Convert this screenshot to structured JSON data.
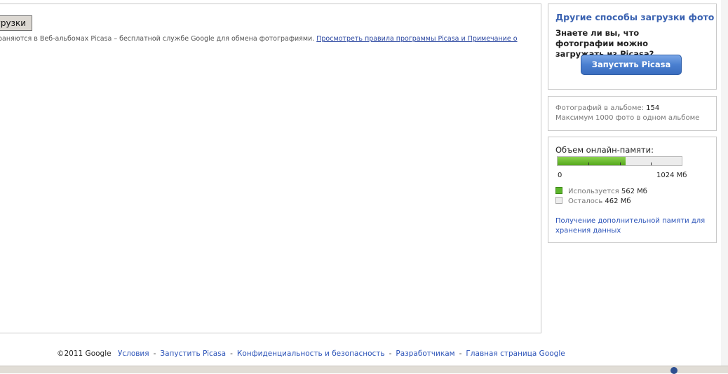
{
  "upload": {
    "button_label": "грузки",
    "terms_text": "раняются в Веб-альбомах Picasa – бесплатной службе Google для обмена фотографиями.",
    "terms_link": "Просмотреть правила программы Picasa и Примечание о"
  },
  "sidebar": {
    "other_ways": {
      "title": "Другие способы загрузки фото",
      "question": "Знаете ли вы, что фотографии можно загружать из Picasa?",
      "button_label": "Запустить Picasa"
    },
    "album_info": {
      "count_label": "Фотографий в альбоме:",
      "count_value": "154",
      "max_text": "Максимум 1000 фото в одном альбоме"
    },
    "storage": {
      "title": "Объем онлайн-памяти:",
      "min_label": "0",
      "max_label": "1024 Мб",
      "used_fraction": 0.549,
      "used_label": "Используется",
      "used_value": "562 Мб",
      "free_label": "Осталось",
      "free_value": "462 Мб",
      "more_link": "Получение дополнительной памяти для хранения данных"
    }
  },
  "footer": {
    "copyright": "©2011 Google",
    "links": [
      "Условия",
      "Запустить Picasa",
      "Конфиденциальность и безопасность",
      "Разработчикам",
      "Главная страница Google"
    ]
  },
  "colors": {
    "link": "#2a52b8",
    "title_blue": "#3a62b1",
    "bar_green": "#5cb52b"
  }
}
